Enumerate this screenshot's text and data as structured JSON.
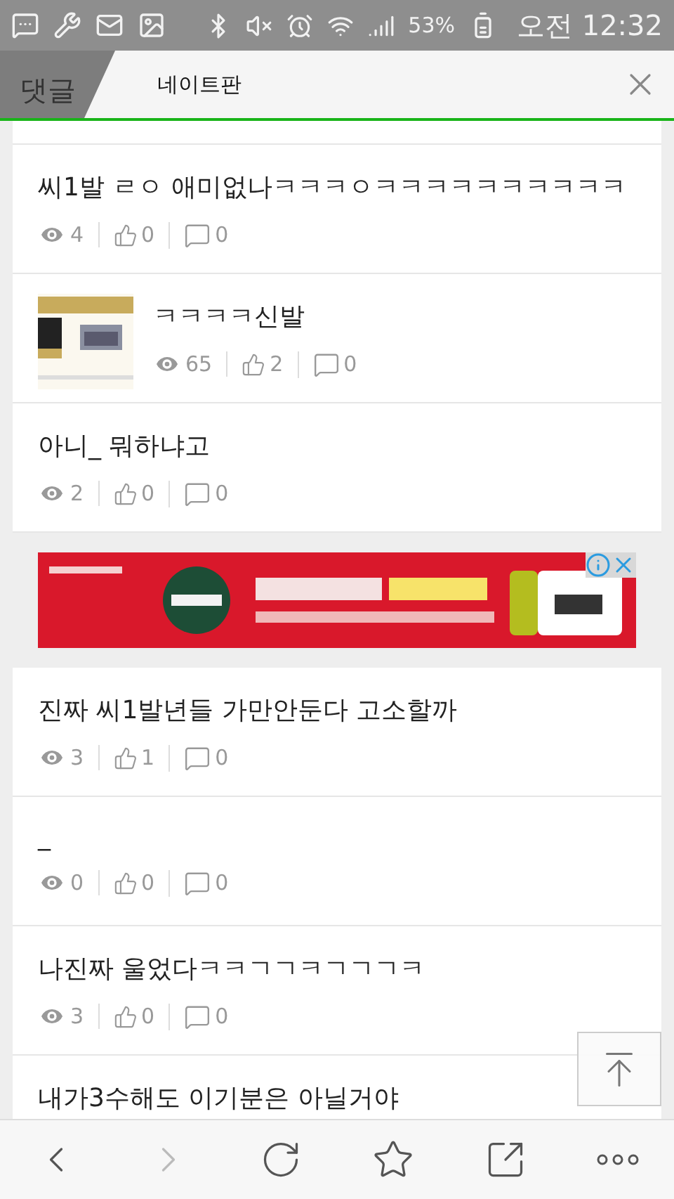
{
  "status_bar": {
    "battery": "53%",
    "time": "오전 12:32"
  },
  "tabs": [
    {
      "label": "댓글",
      "selected": false
    },
    {
      "label": "네이트판",
      "selected": true
    }
  ],
  "sections": [
    {
      "posts": [
        {
          "title": "씨1발 ㄹㅇ 애미없나ㅋㅋㅋㅇㅋㅋㅋㅋㅋㅋㅋㅋㅋㅋ",
          "views": "4",
          "likes": "0",
          "comments": "0"
        },
        {
          "title": "ㅋㅋㅋㅋ신발",
          "views": "65",
          "likes": "2",
          "comments": "0"
        },
        {
          "title": "아니_ 뭐하냐고",
          "views": "2",
          "likes": "0",
          "comments": "0"
        }
      ]
    },
    {
      "posts": [
        {
          "title": "진짜 씨1발년들 가만안둔다 고소할까",
          "views": "3",
          "likes": "1",
          "comments": "0"
        },
        {
          "title": "_",
          "views": "0",
          "likes": "0",
          "comments": "0"
        },
        {
          "title": "나진짜 울었다ㅋㅋㄱㄱㅋㄱㄱㄱㅋ",
          "views": "3",
          "likes": "0",
          "comments": "0"
        },
        {
          "title": "내가3수해도 이기분은 아닐거야"
        }
      ]
    }
  ],
  "toolbar": [
    {
      "kind": "back",
      "disabled": false
    },
    {
      "kind": "forward",
      "disabled": true
    },
    {
      "kind": "reload",
      "disabled": false
    },
    {
      "kind": "bookmark",
      "disabled": false
    },
    {
      "kind": "share",
      "disabled": false
    },
    {
      "kind": "more",
      "disabled": false
    }
  ]
}
